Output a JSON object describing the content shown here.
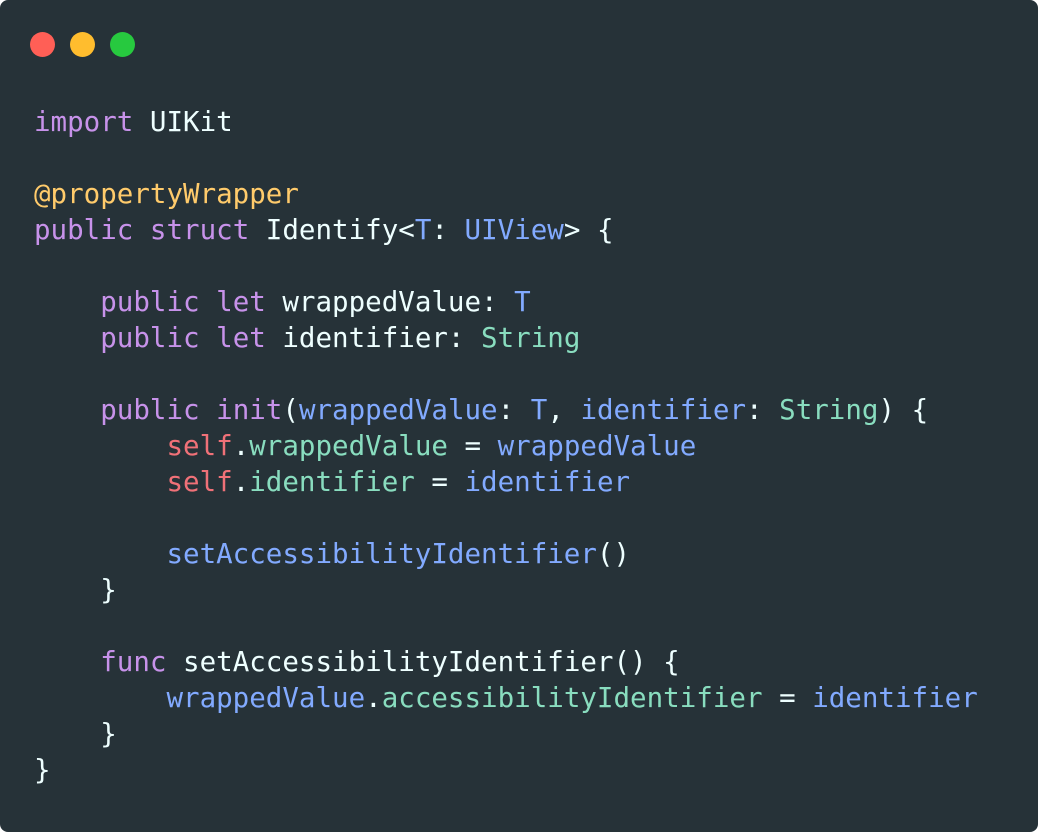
{
  "window": {
    "background": "#263238",
    "buttons": [
      {
        "name": "close-button",
        "color": "#ff5f56"
      },
      {
        "name": "minimize-button",
        "color": "#ffbd2e"
      },
      {
        "name": "maximize-button",
        "color": "#27c93f"
      }
    ]
  },
  "colors": {
    "keyword": "#c792ea",
    "attribute": "#ffcb6b",
    "plain": "#eeffff",
    "type": "#82aaff",
    "param": "#82aaff",
    "builtin": "#89ddbf",
    "self": "#f07178",
    "property": "#89ddbf",
    "call": "#82aaff"
  },
  "code": {
    "lines": [
      [
        {
          "t": "import",
          "c": "keyword"
        },
        {
          "t": " UIKit",
          "c": "plain"
        }
      ],
      [],
      [
        {
          "t": "@propertyWrapper",
          "c": "attribute"
        }
      ],
      [
        {
          "t": "public",
          "c": "keyword"
        },
        {
          "t": " ",
          "c": "plain"
        },
        {
          "t": "struct",
          "c": "keyword"
        },
        {
          "t": " Identify<",
          "c": "plain"
        },
        {
          "t": "T",
          "c": "type"
        },
        {
          "t": ": ",
          "c": "plain"
        },
        {
          "t": "UIView",
          "c": "type"
        },
        {
          "t": "> {",
          "c": "plain"
        }
      ],
      [],
      [
        {
          "t": "    ",
          "c": "plain"
        },
        {
          "t": "public",
          "c": "keyword"
        },
        {
          "t": " ",
          "c": "plain"
        },
        {
          "t": "let",
          "c": "keyword"
        },
        {
          "t": " wrappedValue: ",
          "c": "plain"
        },
        {
          "t": "T",
          "c": "type"
        }
      ],
      [
        {
          "t": "    ",
          "c": "plain"
        },
        {
          "t": "public",
          "c": "keyword"
        },
        {
          "t": " ",
          "c": "plain"
        },
        {
          "t": "let",
          "c": "keyword"
        },
        {
          "t": " identifier: ",
          "c": "plain"
        },
        {
          "t": "String",
          "c": "builtin"
        }
      ],
      [],
      [
        {
          "t": "    ",
          "c": "plain"
        },
        {
          "t": "public",
          "c": "keyword"
        },
        {
          "t": " ",
          "c": "plain"
        },
        {
          "t": "init",
          "c": "keyword"
        },
        {
          "t": "(",
          "c": "plain"
        },
        {
          "t": "wrappedValue",
          "c": "param"
        },
        {
          "t": ": ",
          "c": "plain"
        },
        {
          "t": "T",
          "c": "type"
        },
        {
          "t": ", ",
          "c": "plain"
        },
        {
          "t": "identifier",
          "c": "param"
        },
        {
          "t": ": ",
          "c": "plain"
        },
        {
          "t": "String",
          "c": "builtin"
        },
        {
          "t": ") {",
          "c": "plain"
        }
      ],
      [
        {
          "t": "        ",
          "c": "plain"
        },
        {
          "t": "self",
          "c": "self"
        },
        {
          "t": ".",
          "c": "plain"
        },
        {
          "t": "wrappedValue",
          "c": "property"
        },
        {
          "t": " = ",
          "c": "plain"
        },
        {
          "t": "wrappedValue",
          "c": "param"
        }
      ],
      [
        {
          "t": "        ",
          "c": "plain"
        },
        {
          "t": "self",
          "c": "self"
        },
        {
          "t": ".",
          "c": "plain"
        },
        {
          "t": "identifier",
          "c": "property"
        },
        {
          "t": " = ",
          "c": "plain"
        },
        {
          "t": "identifier",
          "c": "param"
        }
      ],
      [],
      [
        {
          "t": "        ",
          "c": "plain"
        },
        {
          "t": "setAccessibilityIdentifier",
          "c": "call"
        },
        {
          "t": "()",
          "c": "plain"
        }
      ],
      [
        {
          "t": "    }",
          "c": "plain"
        }
      ],
      [],
      [
        {
          "t": "    ",
          "c": "plain"
        },
        {
          "t": "func",
          "c": "keyword"
        },
        {
          "t": " setAccessibilityIdentifier() {",
          "c": "plain"
        }
      ],
      [
        {
          "t": "        ",
          "c": "plain"
        },
        {
          "t": "wrappedValue",
          "c": "param"
        },
        {
          "t": ".",
          "c": "plain"
        },
        {
          "t": "accessibilityIdentifier",
          "c": "property"
        },
        {
          "t": " = ",
          "c": "plain"
        },
        {
          "t": "identifier",
          "c": "param"
        }
      ],
      [
        {
          "t": "    }",
          "c": "plain"
        }
      ],
      [
        {
          "t": "}",
          "c": "plain"
        }
      ]
    ]
  }
}
